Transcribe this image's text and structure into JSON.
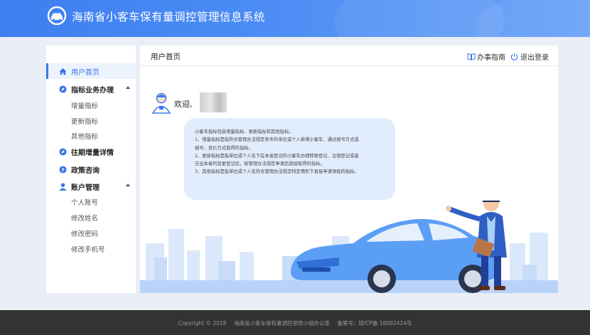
{
  "header": {
    "title": "海南省小客车保有量调控管理信息系统",
    "logo_icon": "car-logo-icon"
  },
  "topnav": {
    "guide_label": "办事指南",
    "logout_label": "退出登录"
  },
  "sidebar": {
    "items": [
      {
        "label": "用户首页",
        "icon": "home-icon",
        "active": true
      },
      {
        "label": "指标业务办理",
        "icon": "compass-icon",
        "expanded": true,
        "children": [
          "增量指标",
          "更新指标",
          "其他指标"
        ]
      },
      {
        "label": "往期增量详情",
        "icon": "compass-icon"
      },
      {
        "label": "政策咨询",
        "icon": "question-icon"
      },
      {
        "label": "账户管理",
        "icon": "user-icon",
        "expanded": true,
        "children": [
          "个人账号",
          "修改姓名",
          "修改密码",
          "修改手机号"
        ]
      }
    ]
  },
  "main": {
    "page_title": "用户首页",
    "welcome": "欢迎,",
    "intro_lines": [
      "小客车指标包括增量指标、更新指标和其他指标。",
      "1、增量指标是指符合管理办法规定条件的单位或个人新增小客车，通过摇号方式或",
      "摇号、竞价方式取得的指标。",
      "2、更新指标是指单位或个人名下在本省登记的小客车办理转移登记、注销登记或者",
      "迁出本省的变更登记后，按管理办法规定申请后直接取得的指标。",
      "3、其他指标是指单位或个人在符合管理办法规定特定情形下直接申请领取的指标。"
    ]
  },
  "footer": {
    "copyright": "Copyright © 2018",
    "org": "海南省小客车保有量调控领导小组办公室",
    "icp": "备案号：琼ICP备 18002424号"
  },
  "colors": {
    "primary": "#3d7ff0",
    "bubble": "#e1edfd",
    "footer": "#333333"
  }
}
